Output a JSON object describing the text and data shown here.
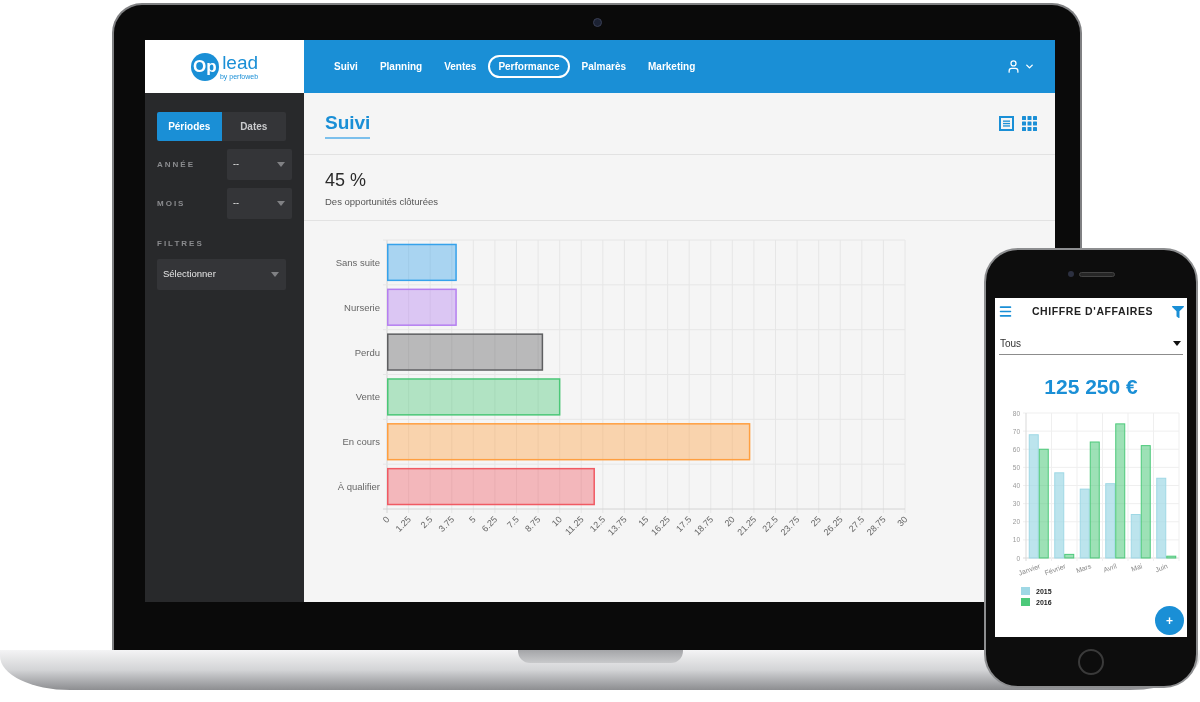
{
  "laptop": {
    "logo": {
      "mark": "Op",
      "text": "lead",
      "tagline": "by perfoweb"
    },
    "nav": [
      {
        "label": "Suivi",
        "selected": false
      },
      {
        "label": "Planning",
        "selected": false
      },
      {
        "label": "Ventes",
        "selected": false
      },
      {
        "label": "Performance",
        "selected": true
      },
      {
        "label": "Palmarès",
        "selected": false
      },
      {
        "label": "Marketing",
        "selected": false
      }
    ],
    "sidebar": {
      "mode_tabs": [
        {
          "label": "Périodes",
          "selected": true
        },
        {
          "label": "Dates",
          "selected": false
        }
      ],
      "fields": [
        {
          "label": "ANNÉE",
          "value": "--"
        },
        {
          "label": "MOIS",
          "value": "--"
        }
      ],
      "filters": {
        "heading": "FILTRES",
        "select": "Sélectionner"
      }
    },
    "page": {
      "tabs": [
        {
          "label": "Suivi",
          "selected": true
        }
      ],
      "stat": {
        "value": "45 %",
        "caption": "Des opportunités clôturées"
      },
      "chart_data": {
        "type": "bar",
        "orientation": "horizontal",
        "categories": [
          "Sans suite",
          "Nurserie",
          "Perdu",
          "Vente",
          "En cours",
          "À qualifier"
        ],
        "values": [
          4,
          4,
          9,
          10,
          21,
          12
        ],
        "colors": [
          "#36a2eb",
          "#b57ff0",
          "#5e5f61",
          "#4bc777",
          "#ff9f40",
          "#f05a63"
        ],
        "xlim": [
          0,
          30
        ],
        "xticks": [
          0,
          1.25,
          2.5,
          3.75,
          5,
          6.25,
          7.5,
          8.75,
          10,
          11.25,
          12.5,
          13.75,
          15,
          16.25,
          17.5,
          18.75,
          20,
          21.25,
          22.5,
          23.75,
          25,
          26.25,
          27.5,
          28.75,
          30
        ],
        "grid": true
      }
    }
  },
  "phone": {
    "title": "CHIFFRE D'AFFAIRES",
    "select": {
      "value": "Tous"
    },
    "total": "125 250 €",
    "chart_data": {
      "type": "bar",
      "categories": [
        "Janvier",
        "Février",
        "Mars",
        "Avril",
        "Mai",
        "Juin"
      ],
      "series": [
        {
          "name": "2015",
          "color": "#9fd8e5",
          "values": [
            68,
            47,
            38,
            41,
            24,
            44
          ]
        },
        {
          "name": "2016",
          "color": "#4cc97a",
          "values": [
            60,
            2,
            64,
            74,
            62,
            1
          ]
        }
      ],
      "ylim": [
        0,
        80
      ],
      "yticks": [
        0,
        10,
        20,
        30,
        40,
        50,
        60,
        70,
        80
      ],
      "grid": true
    },
    "fab": {
      "label": "+"
    }
  }
}
